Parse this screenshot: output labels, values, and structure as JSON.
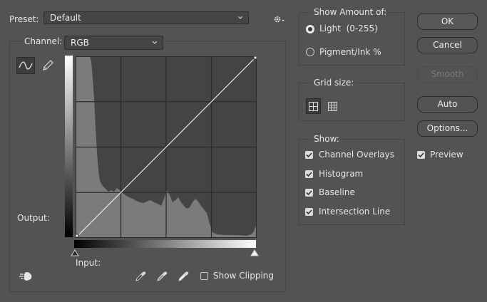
{
  "preset": {
    "label": "Preset:",
    "value": "Default"
  },
  "channel": {
    "label": "Channel:",
    "value": "RGB"
  },
  "graph": {
    "output_label": "Output:",
    "input_label": "Input:",
    "show_clipping_label": "Show Clipping"
  },
  "show_amount": {
    "title": "Show Amount of:",
    "options": [
      {
        "label": "Light  (0-255)",
        "selected": true
      },
      {
        "label": "Pigment/Ink %",
        "selected": false
      }
    ]
  },
  "grid_size": {
    "title": "Grid size:"
  },
  "show": {
    "title": "Show:",
    "items": [
      {
        "label": "Channel Overlays",
        "checked": true
      },
      {
        "label": "Histogram",
        "checked": true
      },
      {
        "label": "Baseline",
        "checked": true
      },
      {
        "label": "Intersection Line",
        "checked": true
      }
    ]
  },
  "buttons": {
    "ok": "OK",
    "cancel": "Cancel",
    "smooth": "Smooth",
    "auto": "Auto",
    "options": "Options..."
  },
  "preview": {
    "label": "Preview",
    "checked": true
  },
  "icons": [
    "gear-icon",
    "curve-tool-icon",
    "pencil-tool-icon",
    "black-point-eyedropper-icon",
    "gray-point-eyedropper-icon",
    "white-point-eyedropper-icon",
    "targeted-adjustment-hand-icon",
    "simple-grid-icon",
    "detailed-grid-icon"
  ]
}
